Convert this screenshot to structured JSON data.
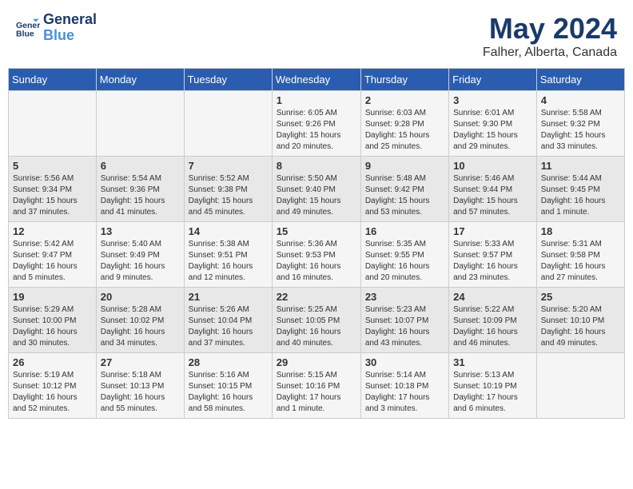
{
  "header": {
    "logo_line1": "General",
    "logo_line2": "Blue",
    "month": "May 2024",
    "location": "Falher, Alberta, Canada"
  },
  "weekdays": [
    "Sunday",
    "Monday",
    "Tuesday",
    "Wednesday",
    "Thursday",
    "Friday",
    "Saturday"
  ],
  "weeks": [
    [
      {
        "num": "",
        "info": ""
      },
      {
        "num": "",
        "info": ""
      },
      {
        "num": "",
        "info": ""
      },
      {
        "num": "1",
        "info": "Sunrise: 6:05 AM\nSunset: 9:26 PM\nDaylight: 15 hours\nand 20 minutes."
      },
      {
        "num": "2",
        "info": "Sunrise: 6:03 AM\nSunset: 9:28 PM\nDaylight: 15 hours\nand 25 minutes."
      },
      {
        "num": "3",
        "info": "Sunrise: 6:01 AM\nSunset: 9:30 PM\nDaylight: 15 hours\nand 29 minutes."
      },
      {
        "num": "4",
        "info": "Sunrise: 5:58 AM\nSunset: 9:32 PM\nDaylight: 15 hours\nand 33 minutes."
      }
    ],
    [
      {
        "num": "5",
        "info": "Sunrise: 5:56 AM\nSunset: 9:34 PM\nDaylight: 15 hours\nand 37 minutes."
      },
      {
        "num": "6",
        "info": "Sunrise: 5:54 AM\nSunset: 9:36 PM\nDaylight: 15 hours\nand 41 minutes."
      },
      {
        "num": "7",
        "info": "Sunrise: 5:52 AM\nSunset: 9:38 PM\nDaylight: 15 hours\nand 45 minutes."
      },
      {
        "num": "8",
        "info": "Sunrise: 5:50 AM\nSunset: 9:40 PM\nDaylight: 15 hours\nand 49 minutes."
      },
      {
        "num": "9",
        "info": "Sunrise: 5:48 AM\nSunset: 9:42 PM\nDaylight: 15 hours\nand 53 minutes."
      },
      {
        "num": "10",
        "info": "Sunrise: 5:46 AM\nSunset: 9:44 PM\nDaylight: 15 hours\nand 57 minutes."
      },
      {
        "num": "11",
        "info": "Sunrise: 5:44 AM\nSunset: 9:45 PM\nDaylight: 16 hours\nand 1 minute."
      }
    ],
    [
      {
        "num": "12",
        "info": "Sunrise: 5:42 AM\nSunset: 9:47 PM\nDaylight: 16 hours\nand 5 minutes."
      },
      {
        "num": "13",
        "info": "Sunrise: 5:40 AM\nSunset: 9:49 PM\nDaylight: 16 hours\nand 9 minutes."
      },
      {
        "num": "14",
        "info": "Sunrise: 5:38 AM\nSunset: 9:51 PM\nDaylight: 16 hours\nand 12 minutes."
      },
      {
        "num": "15",
        "info": "Sunrise: 5:36 AM\nSunset: 9:53 PM\nDaylight: 16 hours\nand 16 minutes."
      },
      {
        "num": "16",
        "info": "Sunrise: 5:35 AM\nSunset: 9:55 PM\nDaylight: 16 hours\nand 20 minutes."
      },
      {
        "num": "17",
        "info": "Sunrise: 5:33 AM\nSunset: 9:57 PM\nDaylight: 16 hours\nand 23 minutes."
      },
      {
        "num": "18",
        "info": "Sunrise: 5:31 AM\nSunset: 9:58 PM\nDaylight: 16 hours\nand 27 minutes."
      }
    ],
    [
      {
        "num": "19",
        "info": "Sunrise: 5:29 AM\nSunset: 10:00 PM\nDaylight: 16 hours\nand 30 minutes."
      },
      {
        "num": "20",
        "info": "Sunrise: 5:28 AM\nSunset: 10:02 PM\nDaylight: 16 hours\nand 34 minutes."
      },
      {
        "num": "21",
        "info": "Sunrise: 5:26 AM\nSunset: 10:04 PM\nDaylight: 16 hours\nand 37 minutes."
      },
      {
        "num": "22",
        "info": "Sunrise: 5:25 AM\nSunset: 10:05 PM\nDaylight: 16 hours\nand 40 minutes."
      },
      {
        "num": "23",
        "info": "Sunrise: 5:23 AM\nSunset: 10:07 PM\nDaylight: 16 hours\nand 43 minutes."
      },
      {
        "num": "24",
        "info": "Sunrise: 5:22 AM\nSunset: 10:09 PM\nDaylight: 16 hours\nand 46 minutes."
      },
      {
        "num": "25",
        "info": "Sunrise: 5:20 AM\nSunset: 10:10 PM\nDaylight: 16 hours\nand 49 minutes."
      }
    ],
    [
      {
        "num": "26",
        "info": "Sunrise: 5:19 AM\nSunset: 10:12 PM\nDaylight: 16 hours\nand 52 minutes."
      },
      {
        "num": "27",
        "info": "Sunrise: 5:18 AM\nSunset: 10:13 PM\nDaylight: 16 hours\nand 55 minutes."
      },
      {
        "num": "28",
        "info": "Sunrise: 5:16 AM\nSunset: 10:15 PM\nDaylight: 16 hours\nand 58 minutes."
      },
      {
        "num": "29",
        "info": "Sunrise: 5:15 AM\nSunset: 10:16 PM\nDaylight: 17 hours\nand 1 minute."
      },
      {
        "num": "30",
        "info": "Sunrise: 5:14 AM\nSunset: 10:18 PM\nDaylight: 17 hours\nand 3 minutes."
      },
      {
        "num": "31",
        "info": "Sunrise: 5:13 AM\nSunset: 10:19 PM\nDaylight: 17 hours\nand 6 minutes."
      },
      {
        "num": "",
        "info": ""
      }
    ]
  ]
}
